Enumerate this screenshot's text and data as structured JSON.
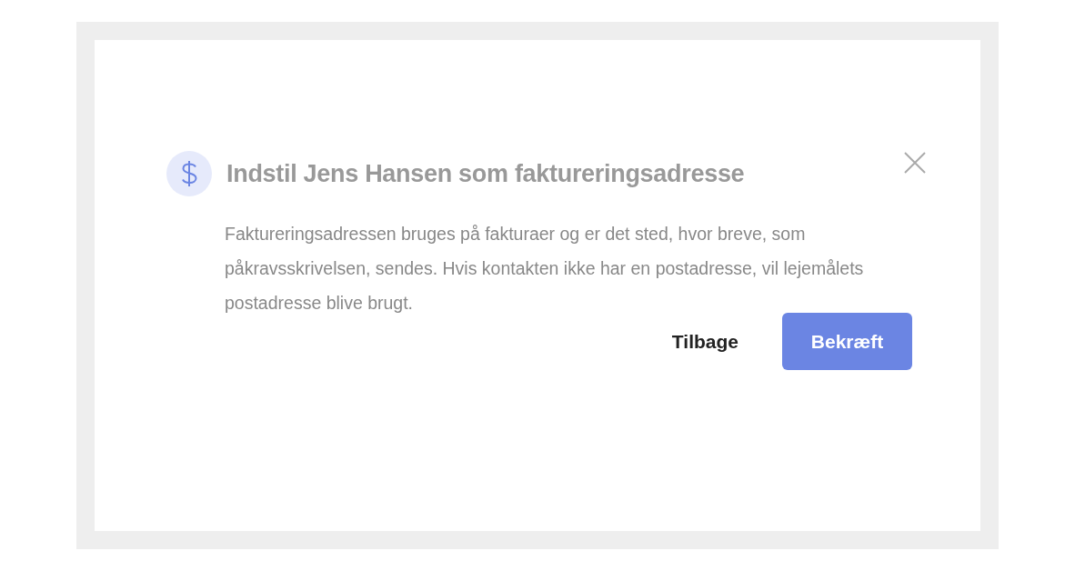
{
  "dialog": {
    "title": "**Indstil Jens Hansen** som faktureringsadresse",
    "body": "Faktureringsadressen bruges på fakturaer og er det sted, hvor breve, som påkravsskrivelsen, sendes. Hvis kontakten ikke har en postadresse, vil lejemålets postadresse blive brugt.",
    "buttons": [
      {
        "label": "Tilbage",
        "kind": "secondary"
      },
      {
        "label": "Bekræft",
        "kind": "primary"
      }
    ]
  }
}
